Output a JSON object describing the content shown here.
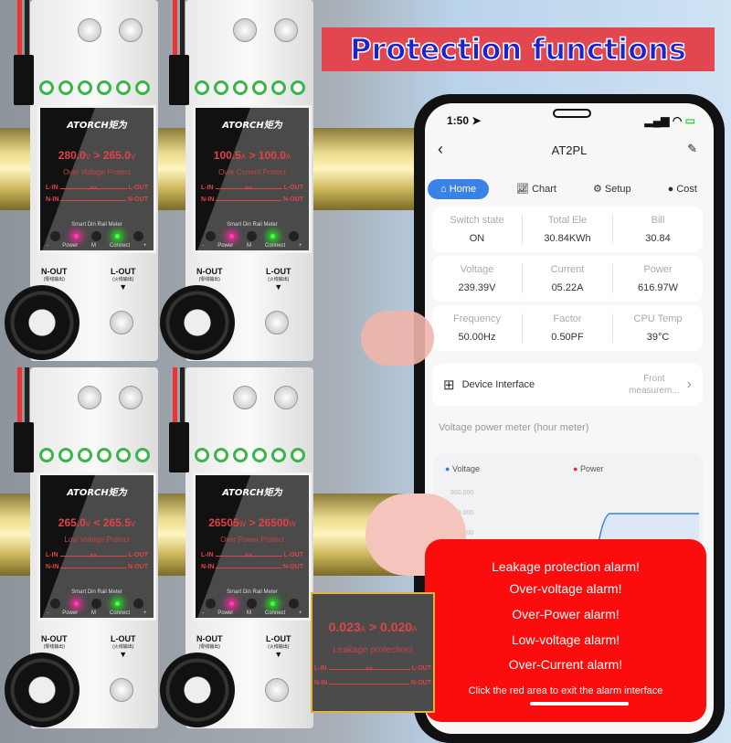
{
  "banner": {
    "title": "Protection functions"
  },
  "meters": [
    {
      "brand": "ATORCH矩为",
      "value_a": "280.0",
      "unit_a": "V",
      "op": ">",
      "value_b": "265.0",
      "unit_b": "V",
      "protect": "Over Voltage Protect"
    },
    {
      "brand": "ATORCH矩为",
      "value_a": "100.5",
      "unit_a": "A",
      "op": ">",
      "value_b": "100.0",
      "unit_b": "A",
      "protect": "Over Current Protect"
    },
    {
      "brand": "ATORCH矩为",
      "value_a": "265.0",
      "unit_a": "V",
      "op": "<",
      "value_b": "265.5",
      "unit_b": "V",
      "protect": "Low Voltage Protect"
    },
    {
      "brand": "ATORCH矩为",
      "value_a": "26505",
      "unit_a": "W",
      "op": ">",
      "value_b": "26500",
      "unit_b": "W",
      "protect": "Over Power Protect"
    }
  ],
  "meter_common": {
    "l_in": "L-IN",
    "n_in": "N-IN",
    "l_out_line": "L-OUT",
    "n_out_line": "N-OUT",
    "breaker": "××",
    "model": "Smart Din Rail Meter",
    "btn_minus": "-",
    "power": "Power",
    "btn_m": "M",
    "connect": "Connect",
    "btn_plus": "+",
    "n_out": "N-OUT",
    "n_out_cn": "(零线输出)",
    "l_out": "L-OUT",
    "l_out_cn": "(火线输出)"
  },
  "colors": {
    "terminal": "#3ab54a",
    "display_red": "#e04444",
    "alarm_red": "#fb0d0d",
    "tab_active": "#3b82e6",
    "banner_bg": "#e2474f",
    "banner_text": "#1e23c8"
  },
  "phone": {
    "time": "1:50",
    "title": "AT2PL",
    "tabs": [
      {
        "label": "Home",
        "icon": "home-icon"
      },
      {
        "label": "Chart",
        "icon": "line-chart-icon"
      },
      {
        "label": "Setup",
        "icon": "gear-icon"
      },
      {
        "label": "Cost",
        "icon": "coin-icon"
      }
    ],
    "stats": [
      [
        {
          "label": "Switch state",
          "value": "ON"
        },
        {
          "label": "Total Ele",
          "value": "30.84KWh"
        },
        {
          "label": "Bill",
          "value": "30.84"
        }
      ],
      [
        {
          "label": "Voltage",
          "value": "239.39V"
        },
        {
          "label": "Current",
          "value": "05.22A"
        },
        {
          "label": "Power",
          "value": "616.97W"
        }
      ],
      [
        {
          "label": "Frequency",
          "value": "50.00Hz"
        },
        {
          "label": "Factor",
          "value": "0.50PF"
        },
        {
          "label": "CPU Temp",
          "value": "39°C"
        }
      ]
    ],
    "device_interface": {
      "label": "Device Interface",
      "value_line1": "Front",
      "value_line2": "measurem..."
    },
    "section_title": "Voltage power meter (hour meter)",
    "chart": {
      "legend": [
        {
          "name": "Voltage",
          "color": "#3b7ddd"
        },
        {
          "name": "Power",
          "color": "#d33"
        }
      ],
      "yticks": [
        "360.000",
        "240.000",
        "120.000"
      ]
    },
    "alarm": {
      "lines": [
        "Leakage protection alarm!",
        "Over-voltage alarm!",
        "Over-Power alarm!",
        "Low-voltage alarm!",
        "Over-Current alarm!"
      ],
      "hint": "Click the red area to exit the alarm interface"
    }
  },
  "leakage": {
    "value_a": "0.023",
    "unit_a": "A",
    "op": ">",
    "value_b": "0.020",
    "unit_b": "A",
    "protect": "Leakage protection!"
  }
}
